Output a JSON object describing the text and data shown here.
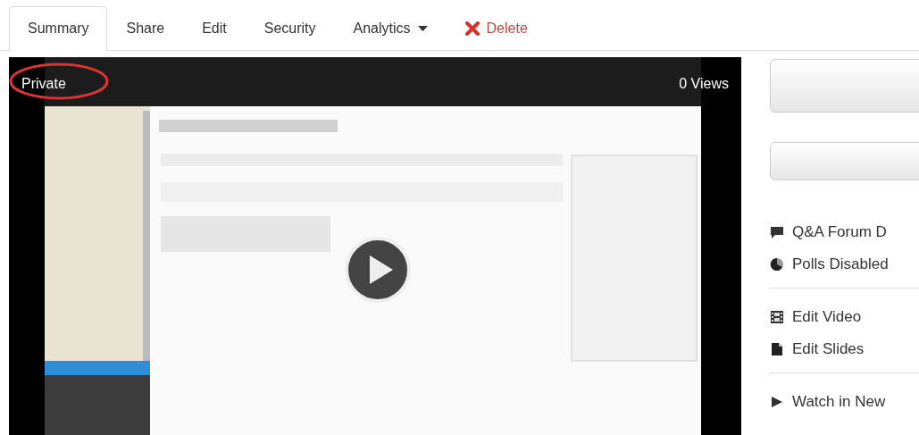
{
  "tabs": [
    {
      "label": "Summary",
      "selected": true,
      "kind": "tab"
    },
    {
      "label": "Share",
      "selected": false,
      "kind": "tab"
    },
    {
      "label": "Edit",
      "selected": false,
      "kind": "tab"
    },
    {
      "label": "Security",
      "selected": false,
      "kind": "tab"
    },
    {
      "label": "Analytics",
      "selected": false,
      "kind": "dropdown"
    },
    {
      "label": "Delete",
      "selected": false,
      "kind": "danger"
    }
  ],
  "video": {
    "privacy": "Private",
    "privacy_circled": true,
    "views": "0 Views"
  },
  "side_buttons": [
    {
      "kind": "tall"
    },
    {
      "kind": "short"
    }
  ],
  "side_groups": [
    [
      {
        "kind": "comment",
        "label": "Q&A Forum D"
      },
      {
        "kind": "pie",
        "label": "Polls Disabled"
      }
    ],
    [
      {
        "kind": "film",
        "label": "Edit Video"
      },
      {
        "kind": "file",
        "label": "Edit Slides"
      }
    ],
    [
      {
        "kind": "play",
        "label": "Watch in New"
      }
    ]
  ]
}
